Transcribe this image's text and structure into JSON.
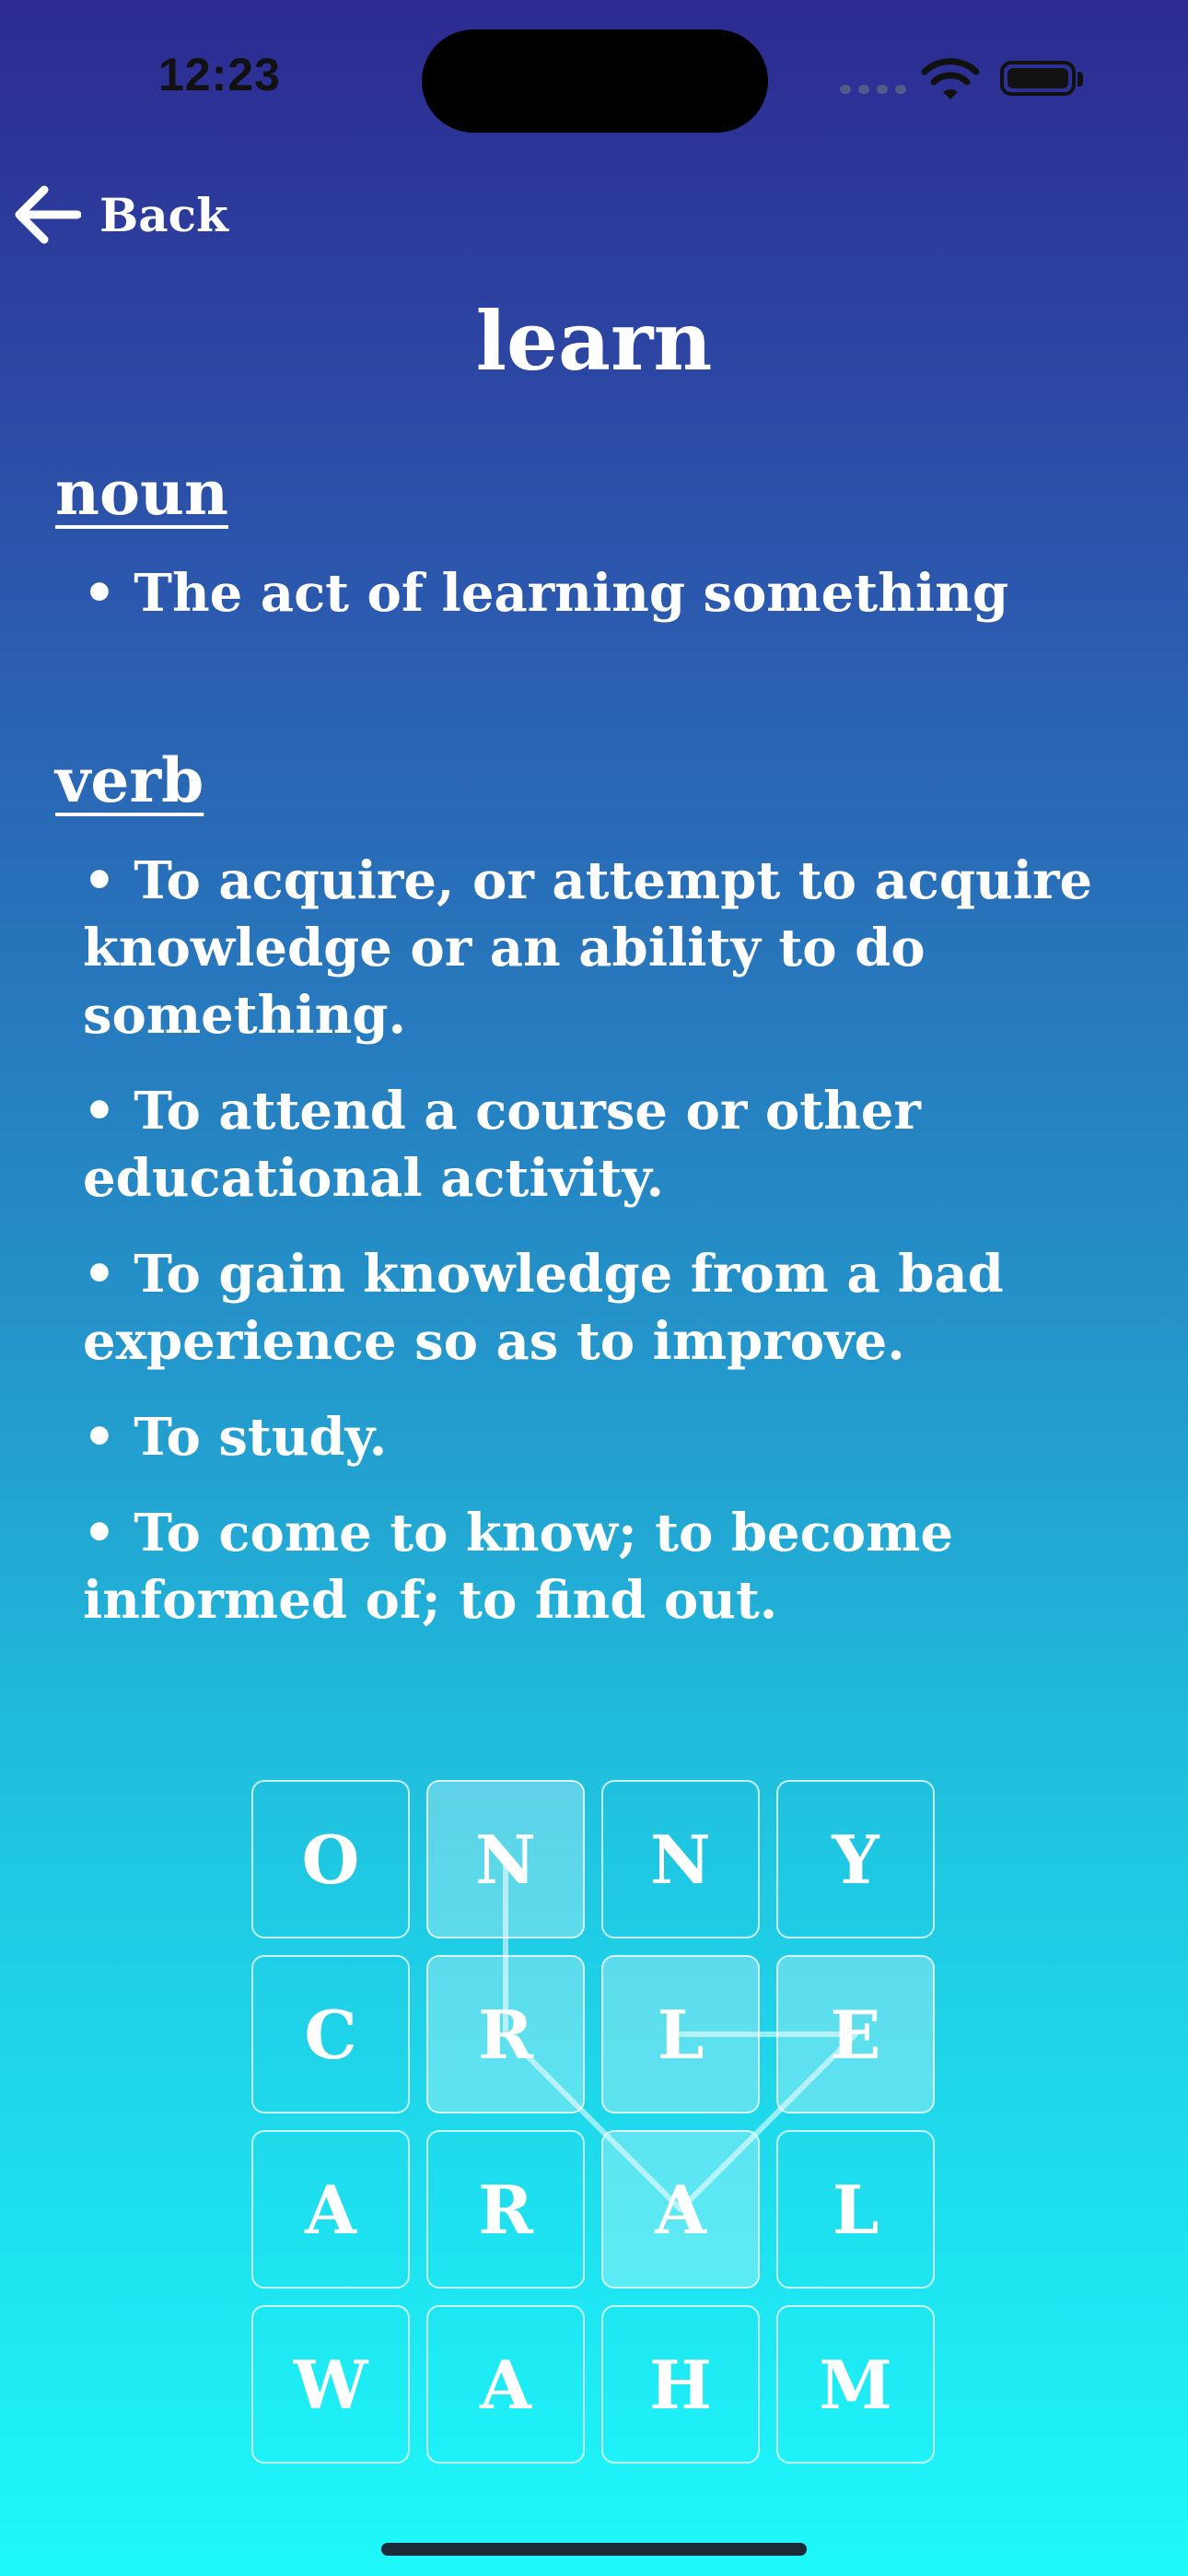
{
  "status_bar": {
    "time": "12:23"
  },
  "nav": {
    "back_label": "Back"
  },
  "word": {
    "title": "learn"
  },
  "noun": {
    "label": "noun",
    "definitions": [
      "• The act of learning something"
    ]
  },
  "verb": {
    "label": "verb",
    "definitions": [
      "• To acquire, or attempt to acquire knowledge or an ability to do something.",
      "• To attend a course or other educational activity.",
      "• To gain knowledge from a bad experience so as to improve.",
      "• To study.",
      "• To come to know; to become informed of; to find out."
    ]
  },
  "puzzle": {
    "rows": [
      [
        "O",
        "N",
        "N",
        "Y"
      ],
      [
        "C",
        "R",
        "L",
        "E"
      ],
      [
        "A",
        "R",
        "A",
        "L"
      ],
      [
        "W",
        "A",
        "H",
        "M"
      ]
    ],
    "selected_path": [
      "N",
      "R",
      "A",
      "E",
      "L"
    ]
  },
  "colors": {
    "gradient_top": "#2d2a91",
    "gradient_bottom": "#1ef9fb",
    "text": "#ffffff"
  }
}
